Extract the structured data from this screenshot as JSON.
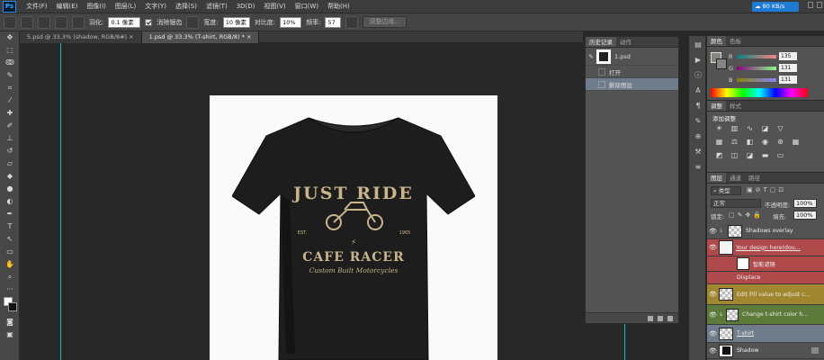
{
  "app": {
    "logo": "Ps"
  },
  "menu": [
    "文件(F)",
    "编辑(E)",
    "图像(I)",
    "图层(L)",
    "文字(Y)",
    "选择(S)",
    "滤镜(T)",
    "3D(D)",
    "视图(V)",
    "窗口(W)",
    "帮助(H)"
  ],
  "network": {
    "speed": "80 KB/s"
  },
  "options": {
    "feather_label": "羽化:",
    "feather_value": "0.1 像素",
    "antialias_label": "消除锯齿",
    "width_label": "宽度:",
    "width_value": "10 像素",
    "contrast_label": "对比度:",
    "contrast_value": "10%",
    "frequency_label": "频率:",
    "frequency_value": "57",
    "refine_edge": "调整边缘..."
  },
  "tabs": [
    {
      "label": "5.psd @ 33.3% (shadow, RGB/8#)",
      "close": "×"
    },
    {
      "label": "1.psd @ 33.3% (T-shirt, RGB/8) *",
      "close": "×"
    }
  ],
  "shirt_print": {
    "line1": "JUST RIDE",
    "est": "EST.",
    "year": "1965",
    "line2": "CAFE RACER",
    "line3": "Custom Built Motorcycles"
  },
  "history": {
    "tabs": [
      "历史记录",
      "动作"
    ],
    "snapshot": "1.psd",
    "steps": [
      {
        "label": "打开",
        "selected": false
      },
      {
        "label": "删除图层",
        "selected": true
      }
    ]
  },
  "color": {
    "tabs": [
      "颜色",
      "色板"
    ],
    "r": "135",
    "g": "131",
    "b": "131"
  },
  "adjustments": {
    "tabs": [
      "调整",
      "样式"
    ],
    "add_label": "添加调整"
  },
  "layers": {
    "tabs": [
      "图层",
      "通道",
      "路径"
    ],
    "filter_label": "类型",
    "blend_mode": "正常",
    "opacity_label": "不透明度:",
    "opacity": "100%",
    "lock_label": "锁定:",
    "fill_label": "填充:",
    "fill": "100%",
    "rows": [
      {
        "name": "Shadows overlay",
        "color": "#535353",
        "link": false
      },
      {
        "name": "Your design here(dou...",
        "color": "#b04a4a",
        "link": true
      },
      {
        "name": "智能滤镜",
        "color": "#b04a4a",
        "link": false
      },
      {
        "name": "Displace",
        "color": "#b04a4a",
        "link": false
      },
      {
        "name": "Edit Fill value to adjust c...",
        "color": "#a0862e",
        "link": false
      },
      {
        "name": "Change t-shirt color h...",
        "color": "#5c7a3a",
        "link": false
      },
      {
        "name": "T-shirt",
        "color": "#6e7c8c",
        "link": true
      },
      {
        "name": "Shadow",
        "color": "#535353",
        "link": false
      },
      {
        "name": "",
        "color": "#535353",
        "link": false
      }
    ]
  },
  "colors": {
    "accent": "#31a8ff",
    "guide": "#00c0d0",
    "selection": "#6e7c8c"
  }
}
